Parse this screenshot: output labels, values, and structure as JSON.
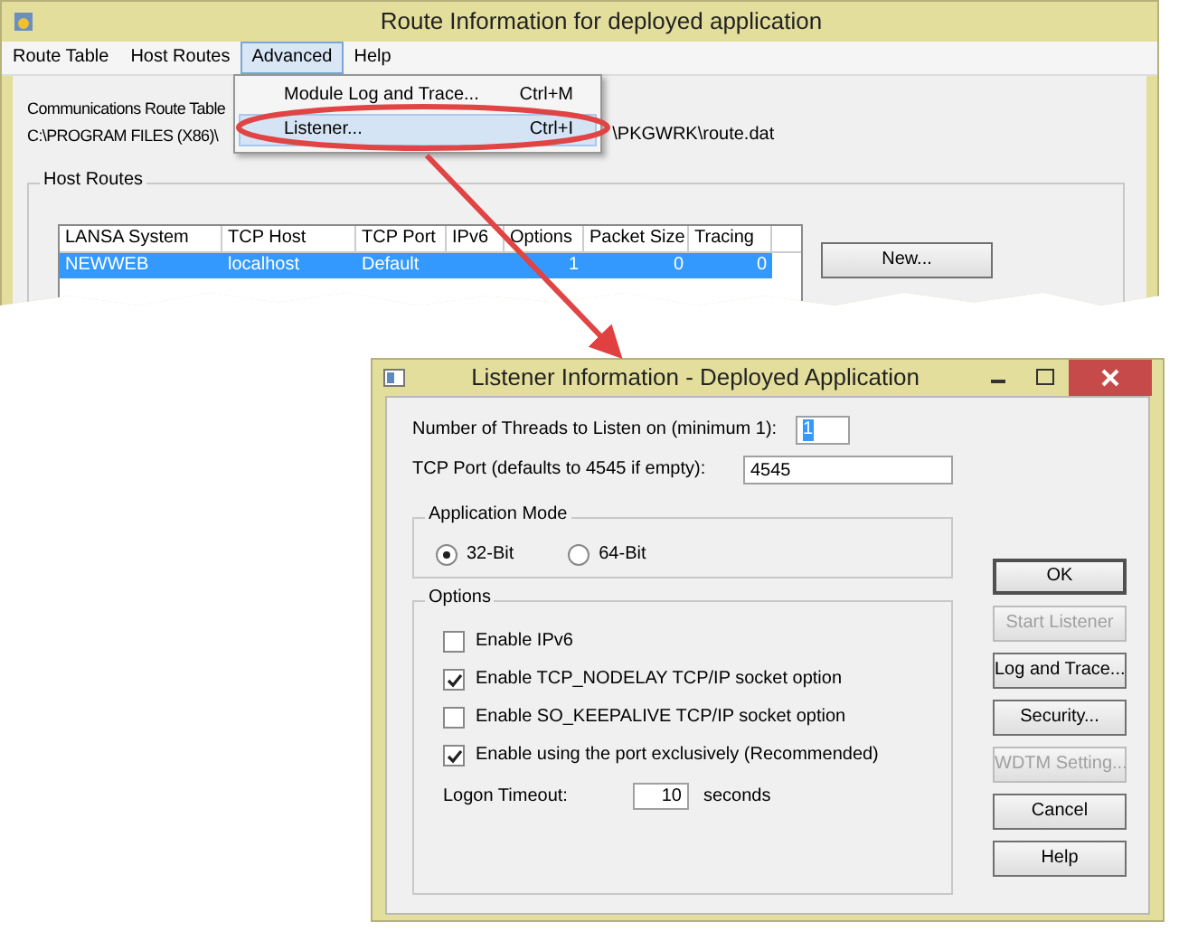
{
  "main_window": {
    "title": "Route Information for deployed application",
    "menu": [
      {
        "label": "Route Table",
        "selected": false
      },
      {
        "label": "Host Routes",
        "selected": false
      },
      {
        "label": "Advanced",
        "selected": true
      },
      {
        "label": "Help",
        "selected": false
      }
    ],
    "dropdown": [
      {
        "label": "Module Log and Trace...",
        "shortcut": "Ctrl+M",
        "selected": false
      },
      {
        "label": "Listener...",
        "shortcut": "Ctrl+I",
        "selected": true
      }
    ],
    "route_table_label": "Communications Route Table",
    "route_path": [
      "C:\\PROGRAM FILES (X86)\\",
      "\\PKGWRK\\route.dat"
    ],
    "host_routes": {
      "title": "Host Routes",
      "columns": [
        "LANSA System",
        "TCP Host",
        "TCP Port",
        "IPv6",
        "Options",
        "Packet Size",
        "Tracing"
      ],
      "rows": [
        {
          "cells": [
            "NEWWEB",
            "localhost",
            "Default",
            null,
            "1",
            "0",
            "0"
          ],
          "selected": true
        }
      ]
    },
    "buttons": [
      "New..."
    ]
  },
  "dialog": {
    "title": "Listener Information - Deployed Application",
    "threads": {
      "label": "Number of Threads to Listen on (minimum 1):",
      "value": "1"
    },
    "tcp_port": {
      "label": "TCP Port (defaults to 4545 if empty):",
      "value": "4545"
    },
    "application_mode": {
      "title": "Application Mode",
      "options": [
        {
          "label": "32-Bit",
          "selected": true
        },
        {
          "label": "64-Bit",
          "selected": false
        }
      ]
    },
    "options": {
      "title": "Options",
      "checkboxes": [
        {
          "label": "Enable IPv6",
          "checked": false
        },
        {
          "label": "Enable TCP_NODELAY TCP/IP socket option",
          "checked": true
        },
        {
          "label": "Enable SO_KEEPALIVE TCP/IP socket option",
          "checked": false
        },
        {
          "label": "Enable using the port exclusively (Recommended)",
          "checked": true
        }
      ],
      "timeout": {
        "label": "Logon Timeout:",
        "value": "10",
        "unit": "seconds"
      }
    },
    "buttons": [
      {
        "label": "OK",
        "disabled": false
      },
      {
        "label": "Start Listener",
        "disabled": true
      },
      {
        "label": "Log and Trace...",
        "disabled": false
      },
      {
        "label": "Security...",
        "disabled": false
      },
      {
        "label": "WDTM Setting...",
        "disabled": true
      },
      {
        "label": "Cancel",
        "disabled": false
      },
      {
        "label": "Help",
        "disabled": false
      }
    ]
  }
}
